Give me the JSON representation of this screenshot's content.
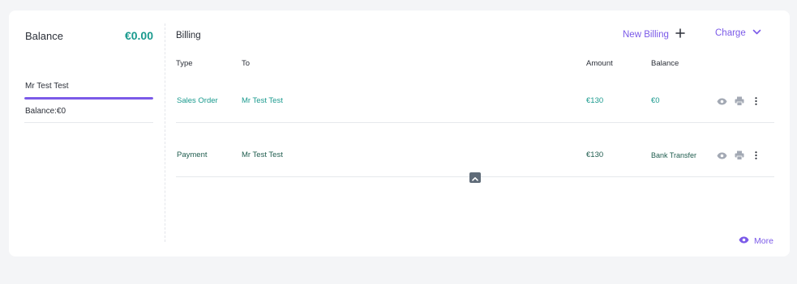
{
  "balance": {
    "title": "Balance",
    "amount": "€0.00"
  },
  "customer": {
    "name": "Mr Test Test",
    "balance_label": "Balance:€0",
    "progress_fraction": 1.0
  },
  "billing": {
    "title": "Billing",
    "new_billing_label": "New Billing",
    "charge_label": "Charge",
    "columns": {
      "type": "Type",
      "to": "To",
      "amount": "Amount",
      "balance": "Balance"
    },
    "rows": [
      {
        "type": "Sales Order",
        "to": "Mr Test Test",
        "amount": "€130",
        "balance": "€0"
      },
      {
        "type": "Payment",
        "to": "Mr Test Test",
        "amount": "€130",
        "balance": "Bank Transfer"
      }
    ],
    "more_label": "More"
  },
  "colors": {
    "accent": "#7b5ae8",
    "teal": "#1a9a8e",
    "dark_green": "#1f5c4e",
    "icon_gray": "#a3a9b4"
  },
  "icons": {
    "new_billing": "plus-icon",
    "charge": "chevron-down-icon",
    "row_actions": [
      "eye-icon",
      "printer-icon",
      "kebab-menu-icon"
    ],
    "collapse": "chevron-up-icon",
    "more": "eye-icon"
  }
}
